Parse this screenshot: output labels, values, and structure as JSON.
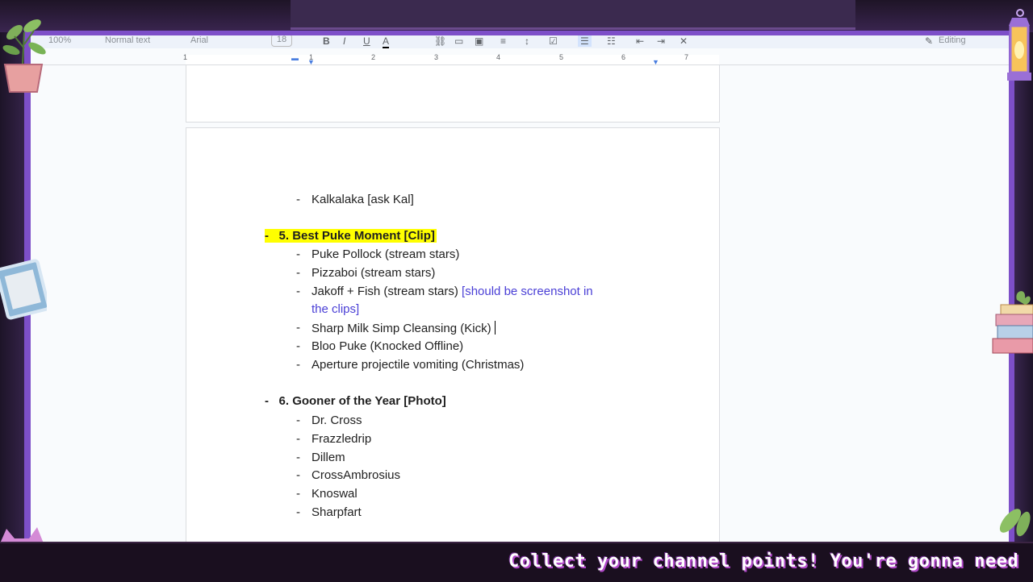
{
  "toolbar": {
    "zoom": "100%",
    "style": "Normal text",
    "font": "Arial",
    "size": "18",
    "mode": "Editing"
  },
  "ruler": {
    "ticks": [
      "1",
      "1",
      "2",
      "3",
      "4",
      "5",
      "6",
      "7"
    ]
  },
  "document": {
    "top_item": "Kalkalaka [ask Kal]",
    "section5": {
      "heading": "5. Best Puke Moment [Clip]",
      "items": [
        "Puke Pollock (stream stars)",
        "Pizzaboi (stream stars)",
        "Jakoff + Fish (stream stars)",
        "Sharp Milk Simp Cleansing (Kick)",
        "Bloo Puke (Knocked Offline)",
        "Aperture projectile vomiting (Christmas)"
      ],
      "note_line1": "[should be screenshot in",
      "note_line2": "the clips]"
    },
    "section6": {
      "heading": "6. Gooner of the Year [Photo]",
      "items": [
        "Dr. Cross",
        "Frazzledrip",
        "Dillem",
        "CrossAmbrosius",
        "Knoswal",
        "Sharpfart"
      ]
    },
    "bullet": "-"
  },
  "overlay": {
    "ticker": "Collect your channel points! You're gonna need"
  },
  "colors": {
    "highlight": "#ffff00",
    "note": "#4a3fd6",
    "frame": "#7d4fc8"
  }
}
